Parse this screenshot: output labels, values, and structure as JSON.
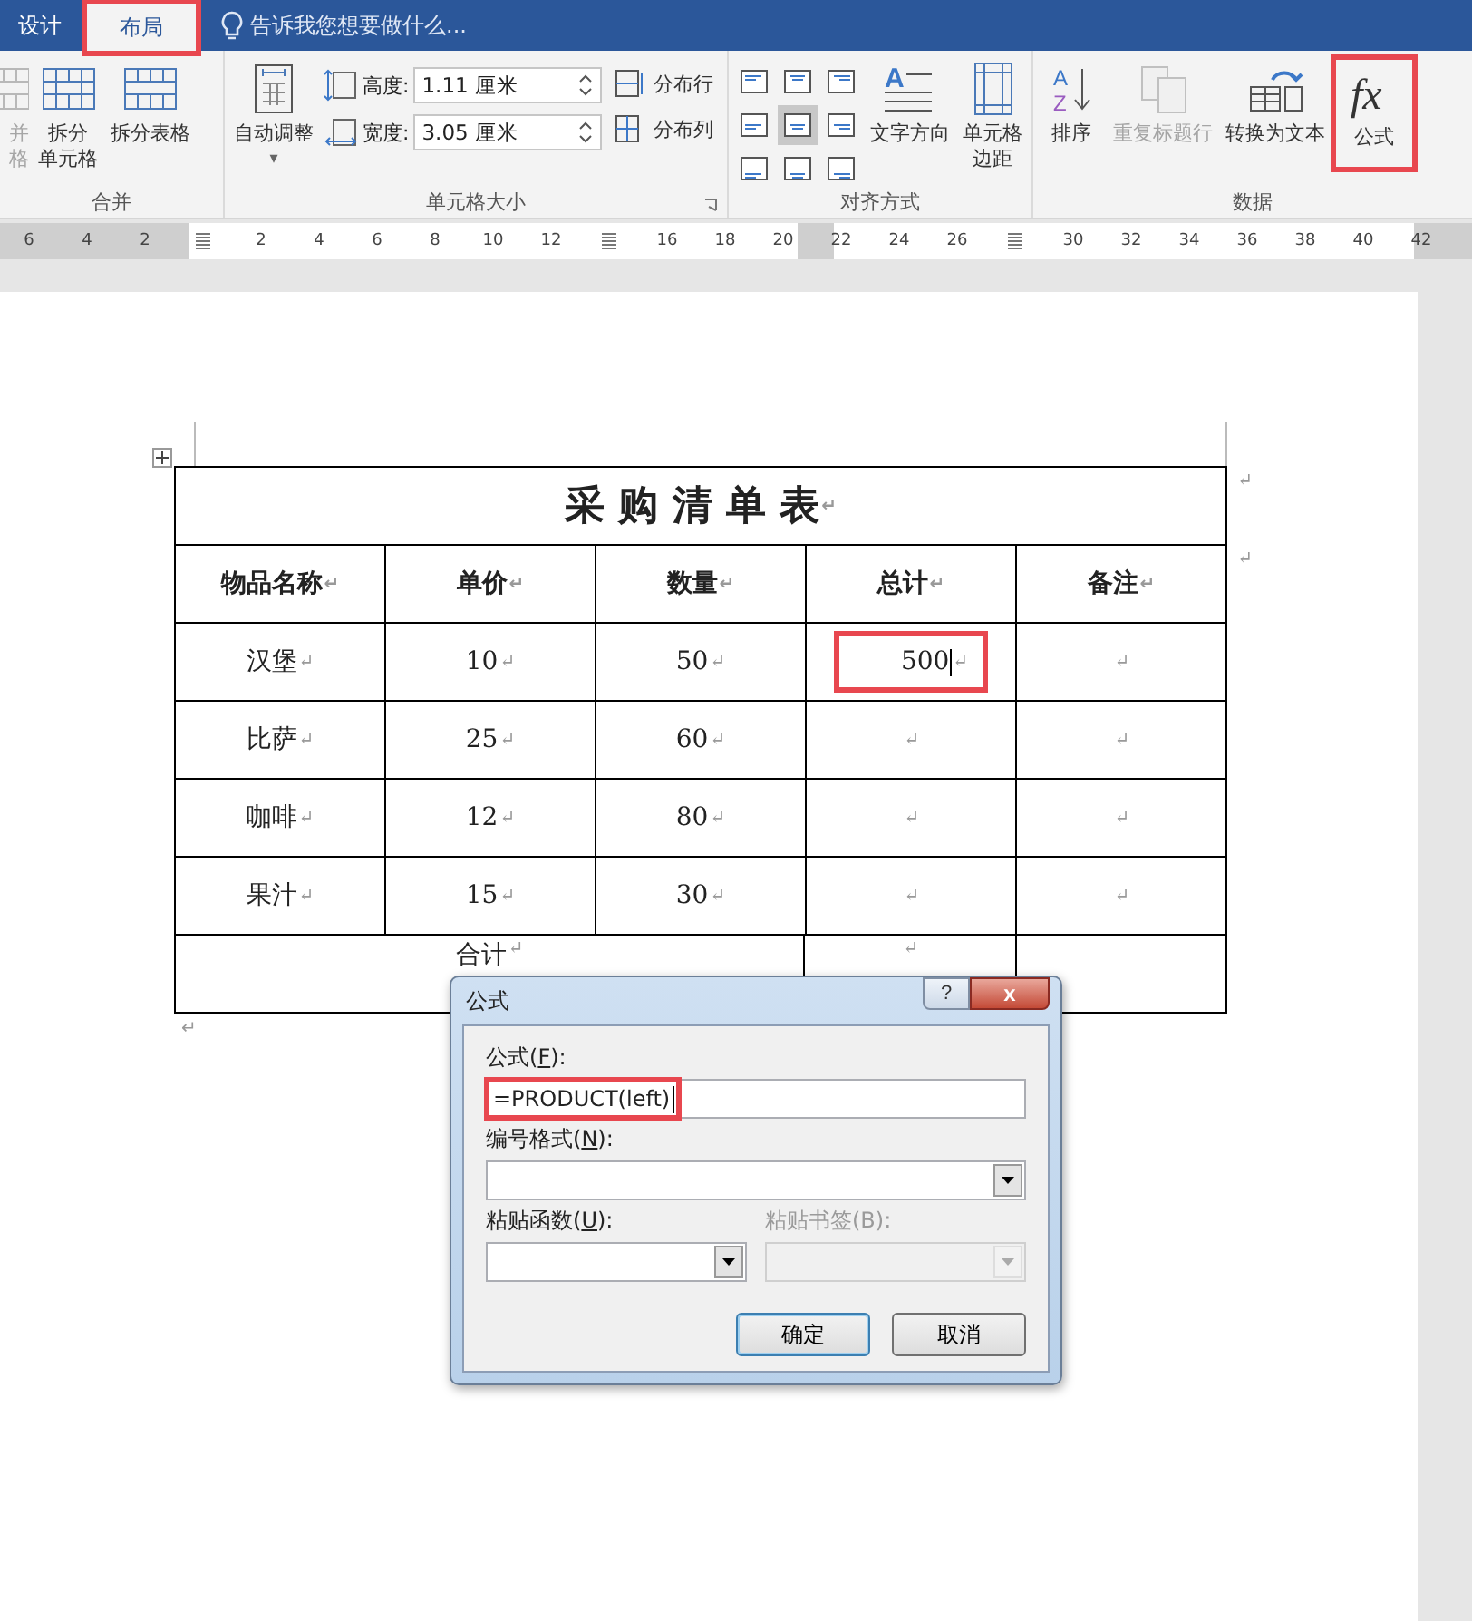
{
  "title_bar": {
    "tabs": [
      {
        "label": "设计",
        "selected": false,
        "highlighted": false
      },
      {
        "label": "布局",
        "selected": true,
        "highlighted": true
      }
    ],
    "tell_me": "告诉我您想要做什么..."
  },
  "ribbon": {
    "groups": [
      {
        "label": "合并",
        "items": [
          {
            "kind": "big",
            "lines": [
              "并",
              "格"
            ],
            "disabled": true,
            "highlighted": false
          },
          {
            "kind": "big",
            "lines": [
              "拆分",
              "单元格"
            ],
            "disabled": false,
            "highlighted": false
          },
          {
            "kind": "big",
            "lines": [
              "拆分表格"
            ],
            "disabled": false,
            "highlighted": false
          }
        ]
      },
      {
        "label": "单元格大小",
        "items": [
          {
            "kind": "big",
            "lines": [
              "自动调整"
            ],
            "disabled": false,
            "highlighted": false,
            "caret": "▾"
          },
          {
            "kind": "spinners",
            "fields": [
              {
                "label": "高度:",
                "value": "1.11 厘米"
              },
              {
                "label": "宽度:",
                "value": "3.05 厘米"
              }
            ]
          },
          {
            "kind": "small",
            "entries": [
              {
                "label": "分布行"
              },
              {
                "label": "分布列"
              }
            ]
          }
        ]
      },
      {
        "label": "对齐方式",
        "items": [
          {
            "kind": "align",
            "cells": [
              {
                "selected": false
              },
              {
                "selected": false
              },
              {
                "selected": false
              },
              {
                "selected": false
              },
              {
                "selected": true
              },
              {
                "selected": false
              },
              {
                "selected": false
              },
              {
                "selected": false
              },
              {
                "selected": false
              }
            ]
          },
          {
            "kind": "big",
            "glyphs": [
              "A"
            ],
            "lines": [
              "文字方向"
            ],
            "disabled": false,
            "highlighted": false
          },
          {
            "kind": "big",
            "lines": [
              "单元格",
              "边距"
            ],
            "disabled": false,
            "highlighted": false
          }
        ]
      },
      {
        "label": "数据",
        "items": [
          {
            "kind": "big",
            "glyphs": [
              "A",
              "Z"
            ],
            "lines": [
              "排序"
            ],
            "disabled": false,
            "highlighted": false
          },
          {
            "kind": "big",
            "lines": [
              "重复标题行"
            ],
            "disabled": true,
            "highlighted": false
          },
          {
            "kind": "big",
            "lines": [
              "转换为文本"
            ],
            "disabled": false,
            "highlighted": false
          },
          {
            "kind": "big",
            "glyphs": [
              "fx"
            ],
            "lines": [
              "公式"
            ],
            "disabled": false,
            "highlighted": true
          }
        ]
      }
    ]
  },
  "ruler": [
    {
      "label": "6"
    },
    {
      "label": "4"
    },
    {
      "label": "2"
    },
    {
      "kind": "marker"
    },
    {
      "label": "2"
    },
    {
      "label": "4"
    },
    {
      "label": "6"
    },
    {
      "label": "8"
    },
    {
      "label": "10"
    },
    {
      "label": "12"
    },
    {
      "kind": "marker"
    },
    {
      "label": "16"
    },
    {
      "label": "18"
    },
    {
      "label": "20"
    },
    {
      "label": "22"
    },
    {
      "label": "24"
    },
    {
      "label": "26"
    },
    {
      "kind": "marker"
    },
    {
      "label": "30"
    },
    {
      "label": "32"
    },
    {
      "label": "34"
    },
    {
      "label": "36"
    },
    {
      "label": "38"
    },
    {
      "label": "40"
    },
    {
      "label": "42"
    }
  ],
  "table": {
    "title": {
      "text": "采 购 清 单 表",
      "mark": "↵"
    },
    "columns": [
      {
        "text": "物品名称",
        "mark": "↵"
      },
      {
        "text": "单价",
        "mark": "↵"
      },
      {
        "text": "数量",
        "mark": "↵"
      },
      {
        "text": "总计",
        "mark": "↵"
      },
      {
        "text": "备注",
        "mark": "↵"
      }
    ],
    "rows": [
      [
        {
          "text": "汉堡",
          "mark": "↵"
        },
        {
          "text": "10",
          "mark": "↵"
        },
        {
          "text": "50",
          "mark": "↵"
        },
        {
          "text": "500",
          "mark": "↵",
          "highlighted": true
        },
        {
          "mark": "↵"
        }
      ],
      [
        {
          "text": "比萨",
          "mark": "↵"
        },
        {
          "text": "25",
          "mark": "↵"
        },
        {
          "text": "60",
          "mark": "↵"
        },
        {
          "mark": "↵"
        },
        {
          "mark": "↵"
        }
      ],
      [
        {
          "text": "咖啡",
          "mark": "↵"
        },
        {
          "text": "12",
          "mark": "↵"
        },
        {
          "text": "80",
          "mark": "↵"
        },
        {
          "mark": "↵"
        },
        {
          "mark": "↵"
        }
      ],
      [
        {
          "text": "果汁",
          "mark": "↵"
        },
        {
          "text": "15",
          "mark": "↵"
        },
        {
          "text": "30",
          "mark": "↵"
        },
        {
          "mark": "↵"
        },
        {
          "mark": "↵"
        }
      ]
    ],
    "total_row": [
      {
        "text": "合计",
        "mark": "↵"
      },
      {
        "mark": "↵"
      }
    ],
    "row_end_marks": [
      "↵",
      "↵"
    ],
    "after_mark": "↵"
  },
  "dialog": {
    "title": "公式",
    "help": "?",
    "close": "x",
    "formula_label": "公式(**F**):",
    "formula": "=PRODUCT(left)",
    "formula_highlighted": true,
    "format_label": "编号格式(**N**):",
    "paste_function_label": "粘贴函数(**U**):",
    "paste_bookmark_label": "粘贴书签(B):",
    "bookmark_disabled": true,
    "buttons": [
      {
        "label": "确定",
        "default": true
      },
      {
        "label": "取消",
        "default": false
      }
    ]
  }
}
